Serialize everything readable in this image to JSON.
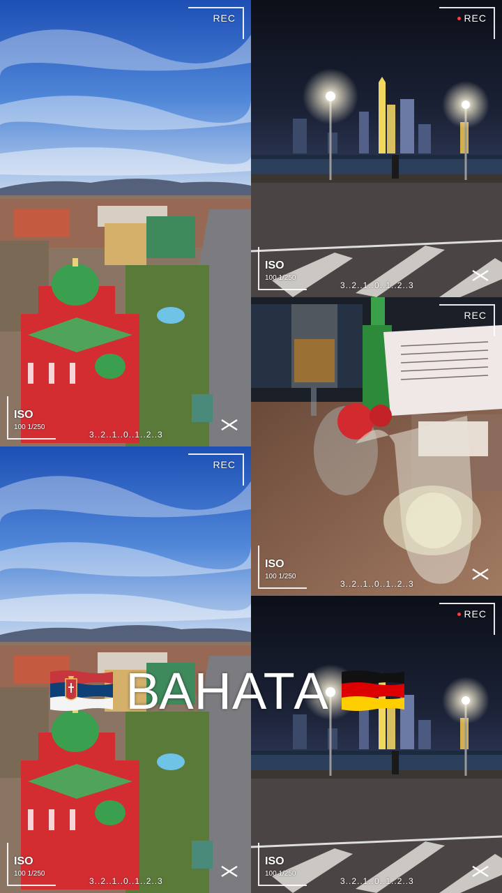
{
  "overlay": {
    "rec_label": "REC",
    "iso_label": "ISO",
    "shutter_label": "100 1/250",
    "scale_label": "3..2..1..0..1..2..3"
  },
  "caption": {
    "text": "ВАНАТА",
    "left_flag": "serbia-flag",
    "right_flag": "germany-flag"
  },
  "tiles": [
    {
      "scene": "church-aerial-day",
      "position": "top-left"
    },
    {
      "scene": "city-skyline-night",
      "position": "top-right"
    },
    {
      "scene": "table-drinks-night",
      "position": "middle-right"
    },
    {
      "scene": "church-aerial-day",
      "position": "bottom-left"
    },
    {
      "scene": "city-skyline-night",
      "position": "bottom-right"
    }
  ],
  "colors": {
    "rec_dot": "#ff3b3b",
    "serbia": [
      "#c6363c",
      "#0c4076",
      "#ffffff"
    ],
    "germany": [
      "#000000",
      "#dd0000",
      "#ffce00"
    ]
  }
}
